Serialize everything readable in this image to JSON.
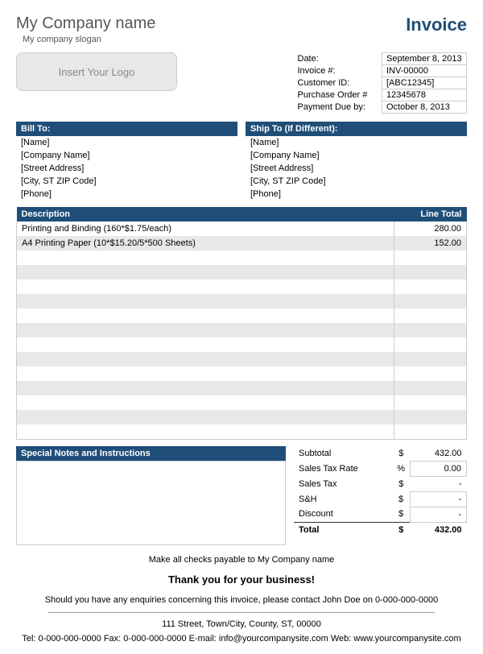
{
  "header": {
    "company_name": "My Company name",
    "slogan": "My company slogan",
    "invoice_title": "Invoice",
    "logo_placeholder": "Insert Your Logo"
  },
  "meta": {
    "date_label": "Date:",
    "date_value": "September 8, 2013",
    "invoice_num_label": "Invoice #:",
    "invoice_num_value": "INV-00000",
    "customer_id_label": "Customer ID:",
    "customer_id_value": "[ABC12345]",
    "po_label": "Purchase Order #",
    "po_value": "12345678",
    "due_label": "Payment Due by:",
    "due_value": "October 8, 2013"
  },
  "billto": {
    "header": "Bill To:",
    "name": "[Name]",
    "company": "[Company Name]",
    "street": "[Street Address]",
    "citystate": "[City, ST  ZIP Code]",
    "phone": "[Phone]"
  },
  "shipto": {
    "header": "Ship To (If Different):",
    "name": "[Name]",
    "company": "[Company Name]",
    "street": "[Street Address]",
    "citystate": "[City, ST  ZIP Code]",
    "phone": "[Phone]"
  },
  "items_header": {
    "desc": "Description",
    "total": "Line Total"
  },
  "items": [
    {
      "desc": "Printing and Binding (160*$1.75/each)",
      "total": "280.00"
    },
    {
      "desc": "A4 Printing Paper (10*$15.20/5*500 Sheets)",
      "total": "152.00"
    }
  ],
  "notes_header": "Special Notes and Instructions",
  "totals": {
    "subtotal_label": "Subtotal",
    "subtotal_sym": "$",
    "subtotal_val": "432.00",
    "taxrate_label": "Sales Tax Rate",
    "taxrate_sym": "%",
    "taxrate_val": "0.00",
    "tax_label": "Sales Tax",
    "tax_sym": "$",
    "tax_val": "-",
    "sh_label": "S&H",
    "sh_sym": "$",
    "sh_val": "-",
    "discount_label": "Discount",
    "discount_sym": "$",
    "discount_val": "-",
    "total_label": "Total",
    "total_sym": "$",
    "total_val": "432.00"
  },
  "footer": {
    "payable": "Make all checks payable to My Company name",
    "thanks": "Thank you for your business!",
    "enquiry": "Should you have any enquiries concerning this invoice, please contact John Doe on 0-000-000-0000",
    "address": "111 Street, Town/City, County, ST, 00000",
    "contact": "Tel: 0-000-000-0000 Fax: 0-000-000-0000 E-mail: info@yourcompanysite.com Web: www.yourcompanysite.com"
  }
}
